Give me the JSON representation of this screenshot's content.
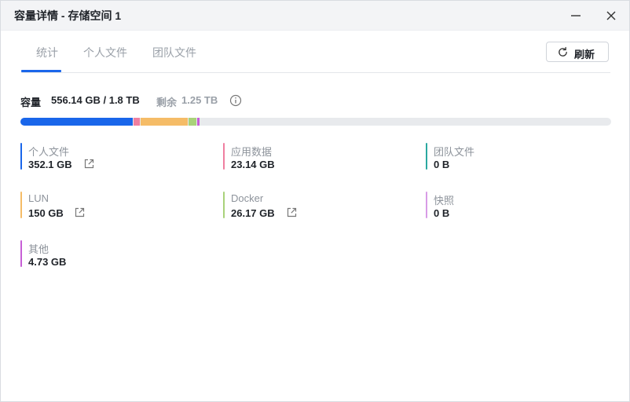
{
  "window": {
    "title": "容量详情 - 存储空间 1"
  },
  "tabs": [
    {
      "label": "统计",
      "active": true
    },
    {
      "label": "个人文件",
      "active": false
    },
    {
      "label": "团队文件",
      "active": false
    }
  ],
  "toolbar": {
    "refresh_label": "刷新"
  },
  "capacity": {
    "label": "容量",
    "value": "556.14 GB / 1.8 TB",
    "remaining_label": "剩余",
    "remaining_value": "1.25 TB"
  },
  "usage_bar": {
    "total_gb": 1843.2,
    "track_color": "#e8eaed",
    "segments": [
      {
        "name": "个人文件",
        "gb": 352.1,
        "color": "#1a66ea"
      },
      {
        "name": "应用数据",
        "gb": 23.14,
        "color": "#ef7fa0"
      },
      {
        "name": "LUN",
        "gb": 150,
        "color": "#f5bc67"
      },
      {
        "name": "Docker",
        "gb": 26.17,
        "color": "#a9d27a"
      },
      {
        "name": "其他",
        "gb": 4.73,
        "color": "#c75fd6"
      }
    ]
  },
  "categories": [
    {
      "name": "个人文件",
      "value": "352.1 GB",
      "color": "#1a66ea",
      "has_link": true,
      "link_icon": "external-link-icon"
    },
    {
      "name": "应用数据",
      "value": "23.14 GB",
      "color": "#ef7fa0",
      "has_link": false
    },
    {
      "name": "团队文件",
      "value": "0 B",
      "color": "#2aa8a0",
      "has_link": false
    },
    {
      "name": "LUN",
      "value": "150 GB",
      "color": "#f5bc67",
      "has_link": true,
      "link_icon": "external-link-icon"
    },
    {
      "name": "Docker",
      "value": "26.17 GB",
      "color": "#a9d27a",
      "has_link": true,
      "link_icon": "external-link-icon"
    },
    {
      "name": "快照",
      "value": "0 B",
      "color": "#d89be6",
      "has_link": false
    },
    {
      "name": "其他",
      "value": "4.73 GB",
      "color": "#c75fd6",
      "has_link": false
    }
  ]
}
